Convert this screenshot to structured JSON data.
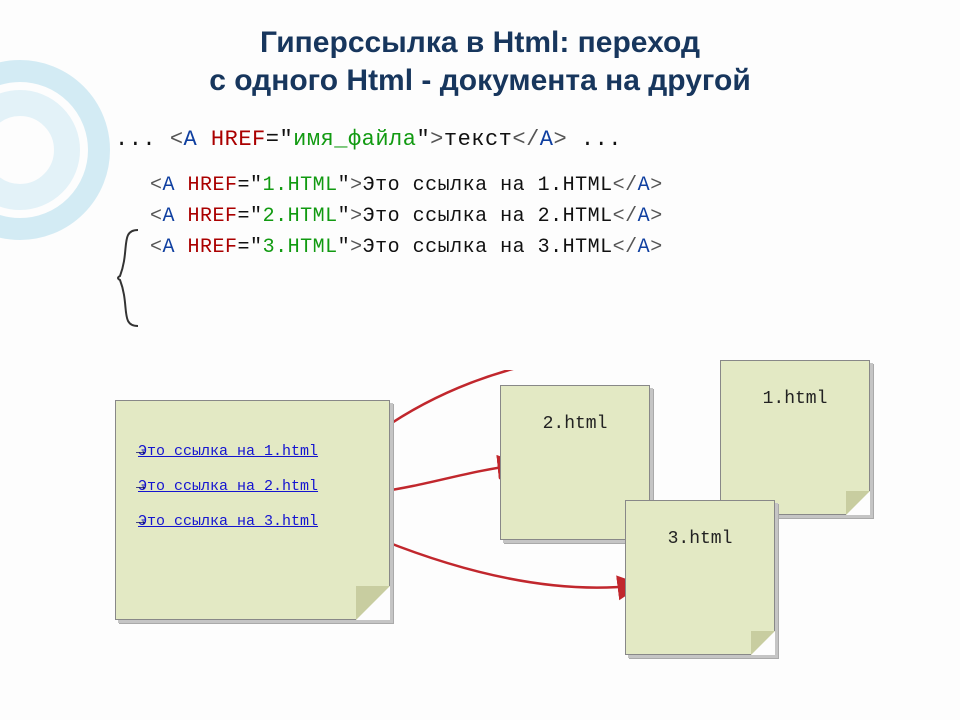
{
  "title_line1": "Гиперссылка в Html: переход",
  "title_line2": "с одного Html - документа на другой",
  "syntax": {
    "dots_before": "... ",
    "lt1": "<",
    "tag_a": "A ",
    "href": "HREF",
    "eq": "=",
    "quote": "\"",
    "value": "имя_файла",
    "gt": ">",
    "text": "текст",
    "lt2": "</",
    "tag_a_close": "A",
    "gt2": ">",
    "dots_after": " ..."
  },
  "examples": [
    {
      "file": "1.HTML",
      "text": "Это ссылка на 1.HTML"
    },
    {
      "file": "2.HTML",
      "text": "Это ссылка на 2.HTML"
    },
    {
      "file": "3.HTML",
      "text": "Это ссылка на 3.HTML"
    }
  ],
  "links": [
    "Это ссылка на 1.html",
    "Это ссылка на 2.html",
    "Это ссылка на 3.html"
  ],
  "targets": {
    "doc1": "1.html",
    "doc2": "2.html",
    "doc3": "3.html"
  }
}
